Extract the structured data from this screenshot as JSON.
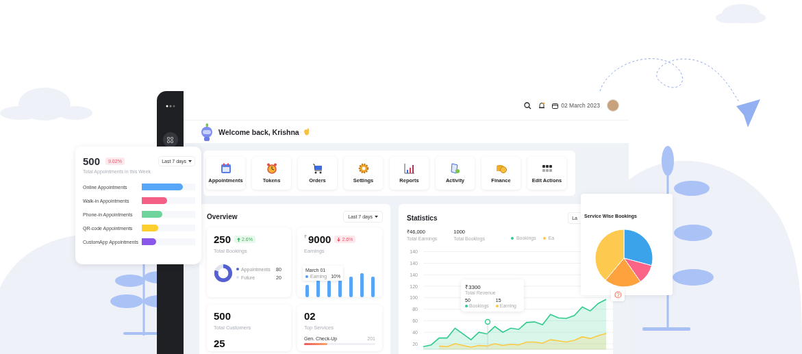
{
  "header": {
    "date": "02 March 2023"
  },
  "welcome": {
    "text": "Welcome back, Krishna"
  },
  "actions": [
    {
      "label": "Appointments",
      "kind": "calendar"
    },
    {
      "label": "Tokens",
      "kind": "clock"
    },
    {
      "label": "Orders",
      "kind": "cart"
    },
    {
      "label": "Settings",
      "kind": "gear"
    },
    {
      "label": "Reports",
      "kind": "chart"
    },
    {
      "label": "Activity",
      "kind": "document"
    },
    {
      "label": "Finance",
      "kind": "coins"
    },
    {
      "label": "Edit Actions",
      "kind": "dots"
    }
  ],
  "appointments_card": {
    "total": "500",
    "change": "9.02%",
    "subtitle": "Total Appointments in this Week",
    "range": "Last 7 days",
    "bars": [
      {
        "label": "Online Appointments",
        "level": 0.77,
        "color": "#58a6f7"
      },
      {
        "label": "Walk-in Appointments",
        "level": 0.47,
        "color": "#f46085"
      },
      {
        "label": "Phone-in Appointments",
        "level": 0.38,
        "color": "#6fd49b"
      },
      {
        "label": "QR-code Appointments",
        "level": 0.31,
        "color": "#fccf2e"
      },
      {
        "label": "CustomApp Appointments",
        "level": 0.27,
        "color": "#8a57ea"
      }
    ]
  },
  "overview": {
    "title": "Overview",
    "range": "Last 7 days",
    "bookings": {
      "value": "250",
      "change": "2.6%",
      "rising": true,
      "label": "Total Bookings",
      "legend": [
        {
          "label": "Appointments",
          "value": "80",
          "color": "#5561d0"
        },
        {
          "label": "Future",
          "value": "20",
          "color": "#dfe3ee"
        }
      ]
    },
    "earnings": {
      "currency": "₹",
      "value": "9000",
      "change": "2.6%",
      "rising": false,
      "label": "Earnings",
      "tooltip": {
        "date": "March 01",
        "label": "Earning",
        "value": "10%"
      }
    },
    "customers": {
      "value": "500",
      "label": "Total Customers",
      "value_2": "25"
    },
    "services": {
      "value": "02",
      "label": "Top Services",
      "items": [
        {
          "name": "Gen. Check-Up",
          "count": "201",
          "level": 0.33
        }
      ]
    }
  },
  "statistics": {
    "title": "Statistics",
    "range": "La",
    "metrics": [
      {
        "value": "₹46,000",
        "label": "Total Earnings"
      },
      {
        "value": "1000",
        "label": "Total Bookings"
      }
    ],
    "extra_y_axis_labels": [
      "140",
      "140"
    ],
    "chart_data": {
      "type": "area",
      "ylim": [
        10,
        140
      ],
      "yticks": [
        20,
        40,
        60,
        80,
        100,
        120,
        140
      ],
      "grid": true,
      "series": [
        {
          "name": "Bookings",
          "color": "#2ecb8c",
          "values": [
            15,
            18,
            30,
            30,
            47,
            37,
            27,
            40,
            37,
            50,
            40,
            47,
            45,
            57,
            58,
            53,
            71,
            65,
            64,
            69,
            84,
            77,
            90,
            97
          ]
        },
        {
          "name": "Ea",
          "color": "#fcc940",
          "values": [
            null,
            null,
            16,
            15,
            20,
            17,
            14,
            17,
            16,
            20,
            17,
            19,
            18,
            23,
            23,
            21,
            27,
            25,
            23,
            26,
            32,
            29,
            34,
            38
          ]
        }
      ]
    },
    "tooltip": {
      "value": "₹3300",
      "label": "Total Revenue",
      "items": [
        {
          "value": "50",
          "label": "Bookings",
          "color": "#2ecb8c"
        },
        {
          "value": "15",
          "label": "Earning",
          "color": "#fcc940"
        }
      ]
    }
  },
  "pie_card": {
    "title": "Service Wise Bookings"
  }
}
